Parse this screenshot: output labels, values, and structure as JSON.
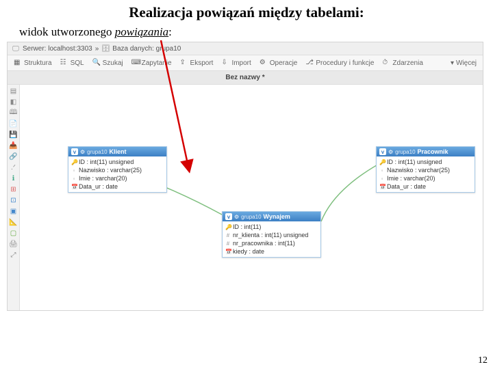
{
  "title": "Realizacja powiązań między tabelami:",
  "subtitle_prefix": "widok utworzonego ",
  "subtitle_em": "powiązania",
  "subtitle_suffix": ":",
  "page_number": "12",
  "breadcrumb": {
    "server_label": "Serwer: localhost:3303",
    "db_label": "Baza danych: grupa10"
  },
  "toolbar": {
    "struktura": "Struktura",
    "sql": "SQL",
    "szukaj": "Szukaj",
    "zapytanie": "Zapytanie",
    "eksport": "Eksport",
    "import": "Import",
    "operacje": "Operacje",
    "procedury": "Procedury i funkcje",
    "zdarzenia": "Zdarzenia",
    "wiecej": "Więcej"
  },
  "designer": {
    "titlebar": "Bez nazwy *"
  },
  "tables": {
    "klient": {
      "schema": "grupa10",
      "name": "Klient",
      "cols": [
        {
          "k": "🔑",
          "txt": "ID : int(11) unsigned"
        },
        {
          "k": "◦",
          "txt": "Nazwisko : varchar(25)"
        },
        {
          "k": "◦",
          "txt": "Imie : varchar(20)"
        },
        {
          "k": "📅",
          "txt": "Data_ur : date"
        }
      ]
    },
    "pracownik": {
      "schema": "grupa10",
      "name": "Pracownik",
      "cols": [
        {
          "k": "🔑",
          "txt": "ID : int(11) unsigned"
        },
        {
          "k": "◦",
          "txt": "Nazwisko : varchar(25)"
        },
        {
          "k": "◦",
          "txt": "Imie : varchar(20)"
        },
        {
          "k": "📅",
          "txt": "Data_ur : date"
        }
      ]
    },
    "wynajem": {
      "schema": "grupa10",
      "name": "Wynajem",
      "cols": [
        {
          "k": "🔑",
          "txt": "ID : int(11)"
        },
        {
          "k": "#",
          "txt": "nr_klienta : int(11) unsigned"
        },
        {
          "k": "#",
          "txt": "nr_pracownika : int(11)"
        },
        {
          "k": "📅",
          "txt": "kiedy : date"
        }
      ]
    }
  }
}
